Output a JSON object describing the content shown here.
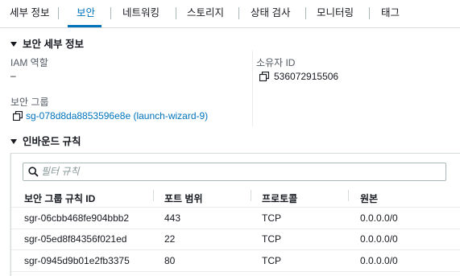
{
  "tabs": [
    "세부 정보",
    "보안",
    "네트워킹",
    "스토리지",
    "상태 검사",
    "모니터링",
    "태그"
  ],
  "active_tab": "보안",
  "security_details": {
    "title": "보안 세부 정보",
    "iam_role_label": "IAM 역할",
    "iam_role_value": "–",
    "owner_id_label": "소유자 ID",
    "owner_id_value": "536072915506",
    "security_groups_label": "보안 그룹",
    "security_group_link": "sg-078d8da8853596e8e (launch-wizard-9)"
  },
  "inbound_rules": {
    "title": "인바운드 규칙",
    "filter_placeholder": "필터 규칙",
    "columns": [
      "보안 그룹 규칙 ID",
      "포트 범위",
      "프로토콜",
      "원본"
    ],
    "rows": [
      [
        "sgr-06cbb468fe904bbb2",
        "443",
        "TCP",
        "0.0.0.0/0"
      ],
      [
        "sgr-05ed8f84356f021ed",
        "22",
        "TCP",
        "0.0.0.0/0"
      ],
      [
        "sgr-0945d9b01e2fb3375",
        "80",
        "TCP",
        "0.0.0.0/0"
      ]
    ]
  },
  "colors": {
    "accent": "#0073bb",
    "text": "#16191f",
    "label": "#545b64",
    "border": "#d5dbdb"
  },
  "icons": [
    "caret-down-icon",
    "copy-icon",
    "search-icon"
  ]
}
